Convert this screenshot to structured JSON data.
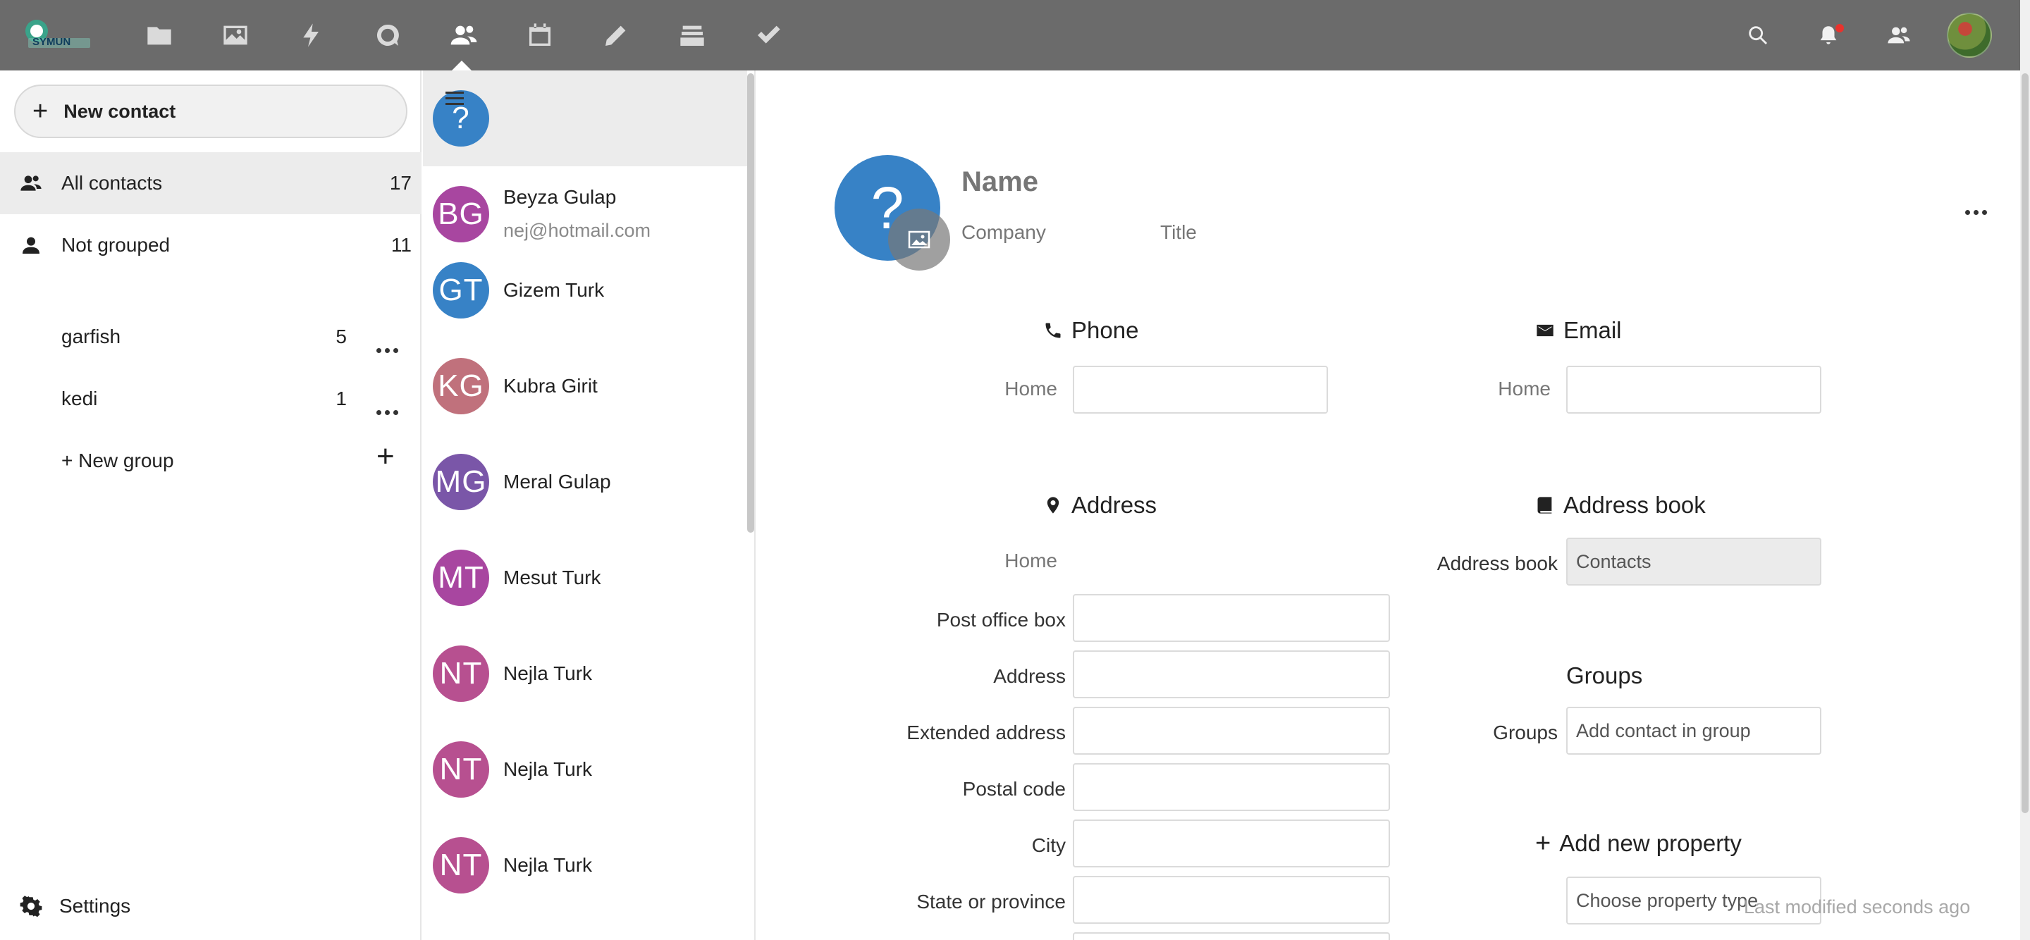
{
  "header": {
    "logo_text": "SYMUN",
    "apps": [
      "files-icon",
      "photos-icon",
      "activity-icon",
      "talk-icon",
      "contacts-icon",
      "calendar-icon",
      "notes-icon",
      "deck-icon",
      "tasks-icon"
    ],
    "active_app": "contacts-icon",
    "right_icons": [
      "search-icon",
      "notifications-icon",
      "contacts-menu-icon"
    ]
  },
  "nav": {
    "new_contact_label": "New contact",
    "items": [
      {
        "label": "All contacts",
        "count": "17",
        "icon": "contacts-icon"
      },
      {
        "label": "Not grouped",
        "count": "11",
        "icon": "user-icon"
      }
    ],
    "groups": [
      {
        "label": "garfish",
        "count": "5"
      },
      {
        "label": "kedi",
        "count": "1"
      }
    ],
    "new_group_label": "+ New group",
    "settings_label": "Settings"
  },
  "contacts": [
    {
      "initials": "?",
      "name": "",
      "email": "",
      "color": "#3782c6"
    },
    {
      "initials": "BG",
      "name": "Beyza Gulap",
      "email": "nej@hotmail.com",
      "color": "#a846a0"
    },
    {
      "initials": "GT",
      "name": "Gizem Turk",
      "email": "",
      "color": "#3782c6"
    },
    {
      "initials": "KG",
      "name": "Kubra Girit",
      "email": "",
      "color": "#c0717c"
    },
    {
      "initials": "MG",
      "name": "Meral Gulap",
      "email": "",
      "color": "#7a56a8"
    },
    {
      "initials": "MT",
      "name": "Mesut Turk",
      "email": "",
      "color": "#a846a0"
    },
    {
      "initials": "NT",
      "name": "Nejla Turk",
      "email": "",
      "color": "#b75090"
    },
    {
      "initials": "NT",
      "name": "Nejla Turk",
      "email": "",
      "color": "#b75090"
    },
    {
      "initials": "NT",
      "name": "Nejla Turk",
      "email": "",
      "color": "#b75090"
    }
  ],
  "details": {
    "avatar": "?",
    "name_placeholder": "Name",
    "company_placeholder": "Company",
    "title_placeholder": "Title",
    "phone": {
      "title": "Phone",
      "label": "Home",
      "value": ""
    },
    "email": {
      "title": "Email",
      "label": "Home",
      "value": ""
    },
    "address": {
      "title": "Address",
      "type_label": "Home",
      "fields": [
        {
          "label": "Post office box",
          "value": ""
        },
        {
          "label": "Address",
          "value": ""
        },
        {
          "label": "Extended address",
          "value": ""
        },
        {
          "label": "Postal code",
          "value": ""
        },
        {
          "label": "City",
          "value": ""
        },
        {
          "label": "State or province",
          "value": ""
        }
      ]
    },
    "addressbook": {
      "title": "Address book",
      "label": "Address book",
      "value": "Contacts"
    },
    "groups": {
      "title": "Groups",
      "label": "Groups",
      "placeholder": "Add contact in group"
    },
    "add_property": {
      "title": "Add new property",
      "placeholder": "Choose property type"
    },
    "last_modified": "Last modified seconds ago"
  },
  "colors": {
    "header_bg": "#6b6b6b",
    "primary": "#3782c6"
  }
}
